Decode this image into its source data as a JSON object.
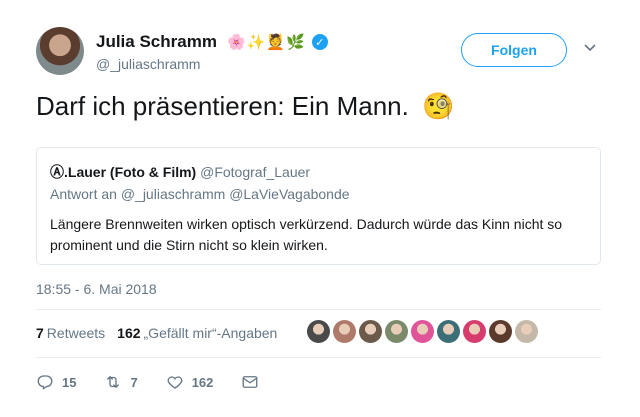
{
  "author": {
    "name": "Julia Schramm",
    "emojis": "🌸✨💆🌿",
    "handle": "@_juliaschramm"
  },
  "follow_label": "Folgen",
  "tweet_text": "Darf ich präsentieren: Ein Mann.",
  "tweet_emoji": "🧐",
  "quoted": {
    "name": "Ⓐ.Lauer (Foto & Film)",
    "handle": "@Fotograf_Lauer",
    "reply_prefix": "Antwort an",
    "reply_to_1": "@_juliaschramm",
    "reply_to_2": "@LaVieVagabonde",
    "body": "Längere Brennweiten wirken optisch verkürzend. Dadurch würde das Kinn nicht so prominent und die Stirn nicht so klein wirken."
  },
  "timestamp": "18:55 - 6. Mai 2018",
  "stats": {
    "retweets_count": "7",
    "retweets_label": "Retweets",
    "likes_count": "162",
    "likes_label": "„Gefällt mir“-Angaben"
  },
  "liker_colors": [
    "#4a4a4a",
    "#b07a6a",
    "#6b5a4a",
    "#7a8a6a",
    "#e0559a",
    "#3c6e78",
    "#d63d6e",
    "#5a3a2a",
    "#c4b8a8"
  ],
  "actions": {
    "reply_count": "15",
    "retweet_count": "7",
    "like_count": "162"
  }
}
